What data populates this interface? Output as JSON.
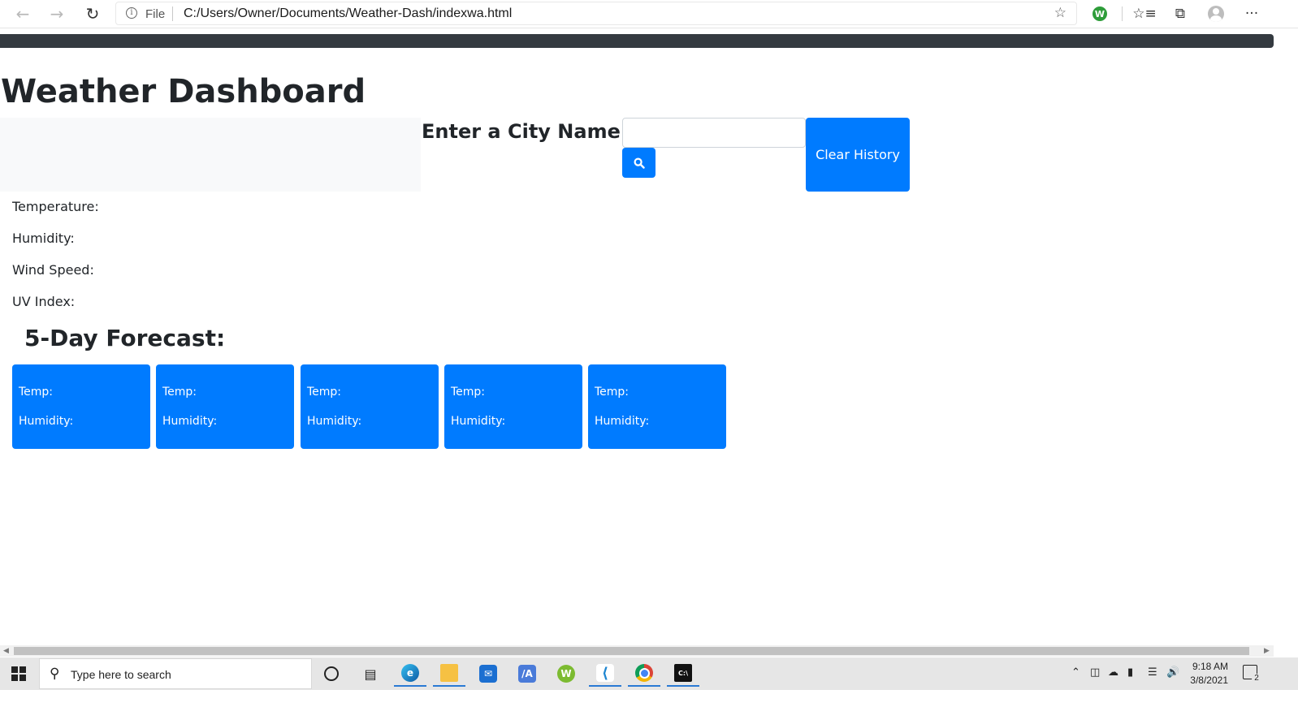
{
  "browser": {
    "back_icon": "arrow-left-icon",
    "forward_icon": "arrow-right-icon",
    "reload_icon": "reload-icon",
    "address": {
      "scheme_label": "File",
      "url": "C:/Users/Owner/Documents/Weather-Dash/indexwa.html"
    },
    "toolbar_icons": [
      "add-favorite-icon",
      "extension-w-icon",
      "favorites-icon",
      "collections-icon",
      "profile-icon",
      "more-icon"
    ],
    "extension_letter": "W",
    "more_label": "···"
  },
  "page": {
    "title": "Weather Dashboard",
    "search": {
      "label": "Enter a City Name:",
      "value": "",
      "button_icon": "search-icon"
    },
    "clear_history_label": "Clear History",
    "current": {
      "temperature_label": "Temperature:",
      "humidity_label": "Humidity:",
      "wind_label": "Wind Speed:",
      "uv_label": "UV Index:"
    },
    "forecast": {
      "title": "5-Day Forecast:",
      "cards": [
        {
          "temp_label": "Temp:",
          "humidity_label": "Humidity:"
        },
        {
          "temp_label": "Temp:",
          "humidity_label": "Humidity:"
        },
        {
          "temp_label": "Temp:",
          "humidity_label": "Humidity:"
        },
        {
          "temp_label": "Temp:",
          "humidity_label": "Humidity:"
        },
        {
          "temp_label": "Temp:",
          "humidity_label": "Humidity:"
        }
      ]
    },
    "colors": {
      "primary": "#007bff",
      "navbar": "#343a40",
      "panel": "#f8f9fa"
    }
  },
  "taskbar": {
    "search_placeholder": "Type here to search",
    "apps": [
      "edge-icon",
      "file-explorer-icon",
      "mail-icon",
      "app-icon",
      "w-app-icon",
      "vscode-icon",
      "chrome-icon",
      "terminal-icon"
    ],
    "clock": {
      "time": "9:18 AM",
      "date": "3/8/2021"
    },
    "notification_count": "2"
  }
}
